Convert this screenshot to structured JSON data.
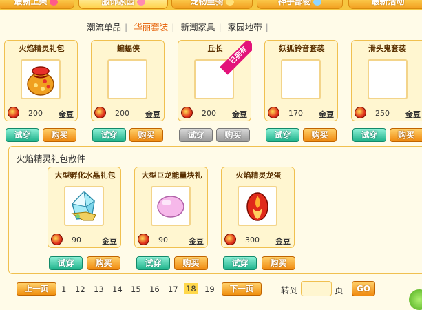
{
  "top_nav": {
    "tabs": [
      {
        "label": "最新上架",
        "active": false
      },
      {
        "label": "服饰家园",
        "active": true
      },
      {
        "label": "宠物坐骑",
        "active": false
      },
      {
        "label": "神手部物",
        "active": false
      },
      {
        "label": "最新活动",
        "active": false
      }
    ]
  },
  "sub_nav": {
    "items": [
      "潮流单品",
      "华丽套装",
      "新潮家具",
      "家园地带"
    ],
    "active_index": 1
  },
  "products": [
    {
      "title": "火焰精灵礼包",
      "price": "200",
      "unit": "金豆",
      "icon": "gift-bag-icon",
      "try_label": "试穿",
      "buy_label": "购买",
      "disabled": false
    },
    {
      "title": "蝙蝠侠",
      "price": "200",
      "unit": "金豆",
      "icon": "",
      "try_label": "试穿",
      "buy_label": "购买",
      "disabled": false
    },
    {
      "title": "丘长",
      "price": "200",
      "unit": "金豆",
      "icon": "",
      "badge": "已拥有",
      "try_label": "试穿",
      "buy_label": "购买",
      "disabled": true
    },
    {
      "title": "妖狐铃音套装",
      "price": "170",
      "unit": "金豆",
      "icon": "",
      "try_label": "试穿",
      "buy_label": "购买",
      "disabled": false
    },
    {
      "title": "滑头鬼套装",
      "price": "250",
      "unit": "金豆",
      "icon": "",
      "try_label": "试穿",
      "buy_label": "购买",
      "disabled": false
    }
  ],
  "bundle": {
    "title": "火焰精灵礼包散件",
    "items": [
      {
        "title": "大型孵化水晶礼包",
        "price": "90",
        "unit": "金豆",
        "icon": "crystal-icon",
        "try_label": "试穿",
        "buy_label": "购买"
      },
      {
        "title": "大型巨龙能量块礼",
        "price": "90",
        "unit": "金豆",
        "icon": "pink-stone-icon",
        "try_label": "试穿",
        "buy_label": "购买"
      },
      {
        "title": "火焰精灵龙蛋",
        "price": "300",
        "unit": "金豆",
        "icon": "fire-egg-icon",
        "try_label": "试穿",
        "buy_label": "购买"
      }
    ]
  },
  "pager": {
    "prev_label": "上一页",
    "next_label": "下一页",
    "pages": [
      "1",
      "12",
      "13",
      "14",
      "15",
      "16",
      "17",
      "18",
      "19"
    ],
    "current": "18",
    "goto_label": "转到",
    "page_unit": "页",
    "go_label": "GO"
  },
  "colors": {
    "accent": "#f08a10",
    "try_button": "#1fb38c",
    "card_border": "#f0c050",
    "owned_badge": "#e3127a"
  }
}
